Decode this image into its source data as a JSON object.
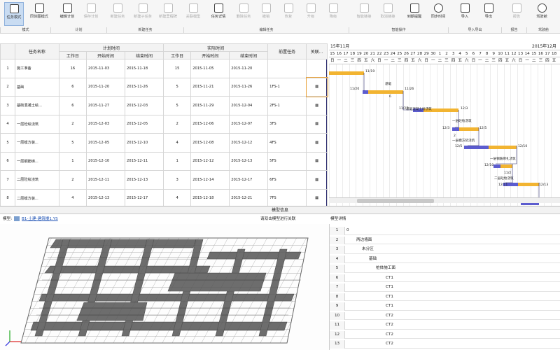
{
  "ribbon": {
    "buttons": [
      {
        "label": "任务模式",
        "icon": "task-mode-icon",
        "disabled": false,
        "active": true
      },
      {
        "label": "同体图模式",
        "icon": "network-mode-icon",
        "disabled": false
      },
      {
        "label": "编辑计划",
        "icon": "edit-plan-icon",
        "disabled": false
      },
      {
        "label": "保存计划",
        "icon": "save-plan-icon",
        "disabled": true
      },
      {
        "label": "新建任务",
        "icon": "new-task-icon",
        "disabled": true
      },
      {
        "label": "新建子任务",
        "icon": "new-subtask-icon",
        "disabled": true
      },
      {
        "label": "新建里程碑",
        "icon": "new-milestone-icon",
        "disabled": true
      },
      {
        "label": "关联模型",
        "icon": "link-model-icon",
        "disabled": true
      },
      {
        "label": "任务详情",
        "icon": "task-detail-icon",
        "disabled": false
      },
      {
        "label": "删除任务",
        "icon": "delete-task-icon",
        "disabled": true
      },
      {
        "label": "撤销",
        "icon": "undo-icon",
        "disabled": true
      },
      {
        "label": "恢复",
        "icon": "redo-icon",
        "disabled": true
      },
      {
        "label": "升级",
        "icon": "upgrade-icon",
        "disabled": true
      },
      {
        "label": "降级",
        "icon": "downgrade-icon",
        "disabled": true
      },
      {
        "label": "智能链接",
        "icon": "smart-link-icon",
        "disabled": true
      },
      {
        "label": "取消链接",
        "icon": "unlink-icon",
        "disabled": true
      },
      {
        "label": "到期提醒",
        "icon": "reminder-icon",
        "disabled": false
      },
      {
        "label": "同步时间",
        "icon": "sync-time-icon",
        "disabled": false
      },
      {
        "label": "导入",
        "icon": "import-icon",
        "disabled": false
      },
      {
        "label": "导出",
        "icon": "export-icon",
        "disabled": false
      },
      {
        "label": "报告",
        "icon": "report-icon",
        "disabled": true
      },
      {
        "label": "驾驶舱",
        "icon": "cockpit-icon",
        "disabled": false
      }
    ],
    "groups": [
      "模式",
      "计划",
      "新建任务",
      "编辑任务",
      "智能操作",
      "导入导出",
      "报告",
      "驾驶舱"
    ]
  },
  "table": {
    "headers": {
      "name": "任务名称",
      "plan": "计划时间",
      "actual": "实际时间",
      "workdays": "工作日",
      "start": "开始时间",
      "end": "结束时间",
      "pred": "前置任务",
      "link": "关联..."
    },
    "rows": [
      {
        "id": "1",
        "name": "施工准备",
        "pd": "16",
        "ps": "2015-11-03",
        "pe": "2015-11-18",
        "ad": "15",
        "as": "2015-11-05",
        "ae": "2015-11-20",
        "pred": "",
        "link": ""
      },
      {
        "id": "2",
        "name": "基础",
        "pd": "6",
        "ps": "2015-11-20",
        "pe": "2015-11-26",
        "ad": "5",
        "as": "2015-11-21",
        "ae": "2015-11-26",
        "pred": "1FS-1",
        "link": "▦"
      },
      {
        "id": "3",
        "name": "基础混凝土绘...",
        "pd": "6",
        "ps": "2015-11-27",
        "pe": "2015-12-03",
        "ad": "5",
        "as": "2015-11-29",
        "ae": "2015-12-04",
        "pred": "2FS-1",
        "link": "▦"
      },
      {
        "id": "4",
        "name": "一层砼绘浇筑",
        "pd": "2",
        "ps": "2015-12-03",
        "pe": "2015-12-05",
        "ad": "2",
        "as": "2015-12-06",
        "ae": "2015-12-07",
        "pred": "3FS",
        "link": "▦"
      },
      {
        "id": "5",
        "name": "一层模方装...",
        "pd": "5",
        "ps": "2015-12-05",
        "pe": "2015-12-10",
        "ad": "4",
        "as": "2015-12-08",
        "ae": "2015-12-12",
        "pred": "4FS",
        "link": "▦"
      },
      {
        "id": "6",
        "name": "一层钢筋绑...",
        "pd": "1",
        "ps": "2015-12-10",
        "pe": "2015-12-11",
        "ad": "1",
        "as": "2015-12-12",
        "ae": "2015-12-13",
        "pred": "5FS",
        "link": "▦"
      },
      {
        "id": "7",
        "name": "二层砼绘浇筑",
        "pd": "2",
        "ps": "2015-12-11",
        "pe": "2015-12-13",
        "ad": "3",
        "as": "2015-12-14",
        "ae": "2015-12-17",
        "pred": "6FS",
        "link": "▦"
      },
      {
        "id": "8",
        "name": "二层模方装...",
        "pd": "4",
        "ps": "2015-12-13",
        "pe": "2015-12-17",
        "ad": "4",
        "as": "2015-12-18",
        "ae": "2015-12-21",
        "pred": "7FS",
        "link": "▦"
      }
    ]
  },
  "gantt": {
    "month1": "15年11月",
    "month2": "2015年12月",
    "days": [
      "15",
      "16",
      "17",
      "18",
      "19",
      "20",
      "21",
      "22",
      "23",
      "24",
      "25",
      "26",
      "27",
      "28",
      "29",
      "30",
      "1",
      "2",
      "3",
      "4",
      "5",
      "6",
      "7",
      "8",
      "9",
      "10",
      "11",
      "12",
      "13",
      "14",
      "15",
      "16",
      "17",
      "18"
    ],
    "weekdays": [
      "日",
      "一",
      "二",
      "三",
      "四",
      "五",
      "六",
      "日",
      "一",
      "二",
      "三",
      "四",
      "五",
      "六",
      "日",
      "一",
      "二",
      "三",
      "四",
      "五",
      "六",
      "日",
      "一",
      "二",
      "三",
      "四",
      "五",
      "六",
      "日",
      "一",
      "二",
      "三",
      "四",
      "五"
    ],
    "labels": [
      {
        "text": "11/19"
      },
      {
        "text": "基础"
      },
      {
        "text": "11/20"
      },
      {
        "text": "11/26"
      },
      {
        "text": "6"
      },
      {
        "text": "基础混凝土绘浇筑"
      },
      {
        "text": "11/27"
      },
      {
        "text": "12/3"
      },
      {
        "text": "一层砼绘浇筑"
      },
      {
        "text": "12/3"
      },
      {
        "text": "12/5"
      },
      {
        "text": "2"
      },
      {
        "text": "一层模方装浇筑"
      },
      {
        "text": "12/5"
      },
      {
        "text": "12/10"
      },
      {
        "text": "一层钢筋绑扎浇筑"
      },
      {
        "text": "12/10"
      },
      {
        "text": "11/2"
      },
      {
        "text": "二层砼绘浇筑"
      },
      {
        "text": "12/11"
      },
      {
        "text": "12/13"
      }
    ]
  },
  "bottom": {
    "split_title": "模型信息",
    "model_prefix": "模型:",
    "model_name": "B1-土建-建筑楼1.YS",
    "model_hint": "请双击模型进行关联",
    "props_title": "模型详情",
    "props": [
      {
        "n": "1",
        "v": "0"
      },
      {
        "n": "2",
        "v": "两边墙面"
      },
      {
        "n": "3",
        "v": "未分区"
      },
      {
        "n": "4",
        "v": "基础"
      },
      {
        "n": "5",
        "v": "桩体施工面"
      },
      {
        "n": "6",
        "v": "CT1"
      },
      {
        "n": "7",
        "v": "CT1"
      },
      {
        "n": "8",
        "v": "CT1"
      },
      {
        "n": "9",
        "v": "CT1"
      },
      {
        "n": "10",
        "v": "CT2"
      },
      {
        "n": "11",
        "v": "CT2"
      },
      {
        "n": "12",
        "v": "CT2"
      },
      {
        "n": "13",
        "v": "CT2"
      }
    ]
  },
  "colors": {
    "plan": "#f2b431",
    "actual": "#5c5ccf",
    "accent": "#2b2b6e"
  }
}
